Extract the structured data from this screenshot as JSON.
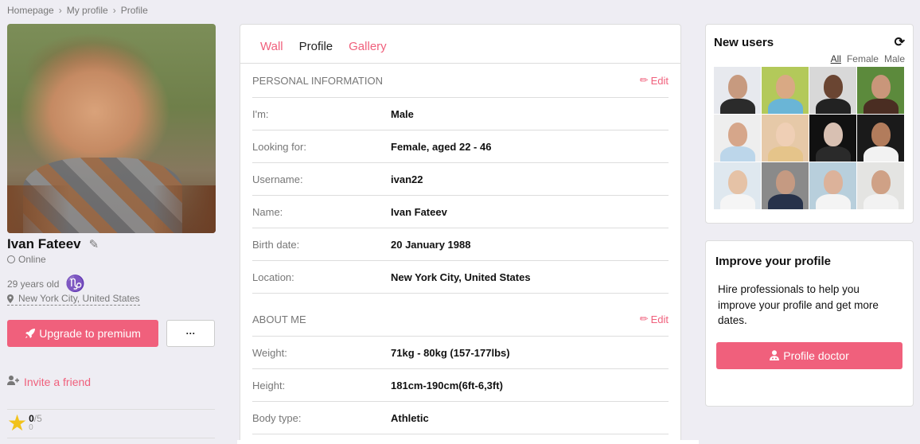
{
  "breadcrumb": [
    {
      "label": "Homepage"
    },
    {
      "label": "My profile"
    },
    {
      "label": "Profile"
    }
  ],
  "breadcrumb_separator": "›",
  "profile": {
    "name": "Ivan Fateev",
    "status": "Online",
    "age": "29 years old",
    "zodiac_symbol": "♑",
    "location": "New York City, United States",
    "upgrade_label": "Upgrade to premium",
    "more_label": "···",
    "invite_label": "Invite a friend",
    "rating": {
      "score": "0",
      "max": "/5",
      "count": "0"
    }
  },
  "tabs": [
    {
      "label": "Wall",
      "active": false
    },
    {
      "label": "Profile",
      "active": true
    },
    {
      "label": "Gallery",
      "active": false
    }
  ],
  "personal_info": {
    "title": "PERSONAL INFORMATION",
    "edit_label": "Edit",
    "rows": [
      {
        "label": "I'm:",
        "value": "Male"
      },
      {
        "label": "Looking for:",
        "value": "Female, aged 22 - 46"
      },
      {
        "label": "Username:",
        "value": "ivan22"
      },
      {
        "label": "Name:",
        "value": "Ivan Fateev"
      },
      {
        "label": "Birth date:",
        "value": "20 January 1988"
      },
      {
        "label": "Location:",
        "value": "New York City, United States"
      }
    ]
  },
  "about_me": {
    "title": "ABOUT ME",
    "edit_label": "Edit",
    "rows": [
      {
        "label": "Weight:",
        "value": "71kg - 80kg (157-177lbs)"
      },
      {
        "label": "Height:",
        "value": "181cm-190cm(6ft-6,3ft)"
      },
      {
        "label": "Body type:",
        "value": "Athletic"
      }
    ]
  },
  "new_users": {
    "title": "New users",
    "filters": [
      {
        "label": "All",
        "selected": true
      },
      {
        "label": "Female",
        "selected": false
      },
      {
        "label": "Male",
        "selected": false
      }
    ],
    "thumbs": [
      {
        "bg": "#e7e9ee",
        "skin": "#c79a7f",
        "cloth": "#2b2b2b"
      },
      {
        "bg": "#b3c95a",
        "skin": "#d9a984",
        "cloth": "#6ab5d6"
      },
      {
        "bg": "#d8d8d8",
        "skin": "#6a4532",
        "cloth": "#222222"
      },
      {
        "bg": "#5c8a3c",
        "skin": "#c9967a",
        "cloth": "#4a2d22"
      },
      {
        "bg": "#eeeeee",
        "skin": "#d6a68a",
        "cloth": "#bcd6ea"
      },
      {
        "bg": "#e6c9a8",
        "skin": "#efcfb5",
        "cloth": "#e5c48a"
      },
      {
        "bg": "#111111",
        "skin": "#d8c0b2",
        "cloth": "#2a2a2a"
      },
      {
        "bg": "#1a1a1a",
        "skin": "#b27c5c",
        "cloth": "#f2f2f2"
      },
      {
        "bg": "#dfe8ef",
        "skin": "#e5c2a6",
        "cloth": "#f5f5f5"
      },
      {
        "bg": "#8a8a8a",
        "skin": "#c59a82",
        "cloth": "#27324a"
      },
      {
        "bg": "#b8cfdc",
        "skin": "#dcb29a",
        "cloth": "#f4f4f4"
      },
      {
        "bg": "#e4e4e2",
        "skin": "#cfa186",
        "cloth": "#f2f2f2"
      }
    ]
  },
  "improve": {
    "title": "Improve your profile",
    "text": "Hire professionals to help you improve your profile and get more dates.",
    "button_label": "Profile doctor"
  },
  "colors": {
    "accent": "#f0607c",
    "background": "#eeedf3",
    "zodiac": "#4cb81c",
    "star": "#f1c21b"
  }
}
